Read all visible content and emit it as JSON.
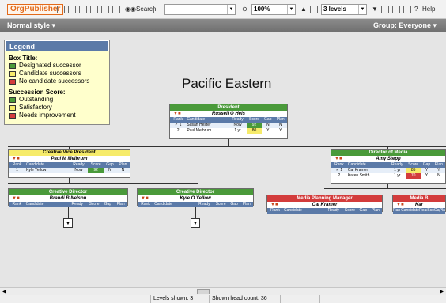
{
  "toolbar": {
    "logo": "OrgPublisher",
    "search_label": "Search",
    "search_value": "",
    "zoom": "100%",
    "levels": "3 levels",
    "help_label": "Help"
  },
  "stylebar": {
    "style": "Normal style",
    "group": "Group: Everyone"
  },
  "legend": {
    "title": "Legend",
    "box_title": "Box Title:",
    "box_items": [
      {
        "label": "Designated successor",
        "color": "#4a9a3a"
      },
      {
        "label": "Candidate successors",
        "color": "#f6eb6a"
      },
      {
        "label": "No candidate successors",
        "color": "#d33c3c"
      }
    ],
    "score_title": "Succession Score:",
    "score_items": [
      {
        "label": "Outstanding",
        "color": "#4a9a3a"
      },
      {
        "label": "Satisfactory",
        "color": "#f6eb6a"
      },
      {
        "label": "Needs improvement",
        "color": "#d33c3c"
      }
    ]
  },
  "chart_title": "Pacific Eastern",
  "headers": {
    "rank": "Rank",
    "candidate": "Candidate",
    "ready": "Ready",
    "score": "Score",
    "gap": "Gap",
    "plan": "Plan"
  },
  "boxes": {
    "president": {
      "title": "President",
      "name": "Russell O Hels",
      "color": "#4a9a3a",
      "rows": [
        {
          "rank": "✓ 1",
          "cand": "Susan Hester",
          "ready": "Now",
          "score": "92",
          "score_color": "#4a9a3a",
          "gap": "N",
          "plan": "N"
        },
        {
          "rank": "2",
          "cand": "Paul Melbrum",
          "ready": "1 yr",
          "score": "80",
          "score_color": "#f6eb6a",
          "gap": "Y",
          "plan": "Y"
        }
      ]
    },
    "cvp": {
      "title": "Creative Vice President",
      "name": "Paul M Melbrum",
      "color": "#f6eb6a",
      "rows": [
        {
          "rank": "1",
          "cand": "Kyle Yellow",
          "ready": "Now",
          "score": "92",
          "score_color": "#4a9a3a",
          "gap": "N",
          "plan": "N"
        }
      ]
    },
    "dir_media": {
      "title": "Director of Media",
      "name": "Amy Stepp",
      "color": "#4a9a3a",
      "rows": [
        {
          "rank": "✓ 1",
          "cand": "Cal Kramer",
          "ready": "1 yr",
          "score": "85",
          "score_color": "#f6eb6a",
          "gap": "Y",
          "plan": "Y"
        },
        {
          "rank": "2",
          "cand": "Karen Smith",
          "ready": "1 yr",
          "score": "70",
          "score_color": "#d33c3c",
          "gap": "Y",
          "plan": "N"
        }
      ]
    },
    "cd1": {
      "title": "Creative Director",
      "name": "Brandi B Nelson",
      "color": "#4a9a3a",
      "rows": []
    },
    "cd2": {
      "title": "Creative Director",
      "name": "Kyle O Yellow",
      "color": "#4a9a3a",
      "rows": []
    },
    "mpm": {
      "title": "Media Planning Manager",
      "name": "Cal Kramer",
      "color": "#d33c3c",
      "rows": []
    },
    "mb": {
      "title": "Media B",
      "name": "Kar",
      "color": "#d33c3c",
      "rows": []
    }
  },
  "status": {
    "levels": "Levels shown: 3",
    "headcount": "Shown head count: 36"
  }
}
